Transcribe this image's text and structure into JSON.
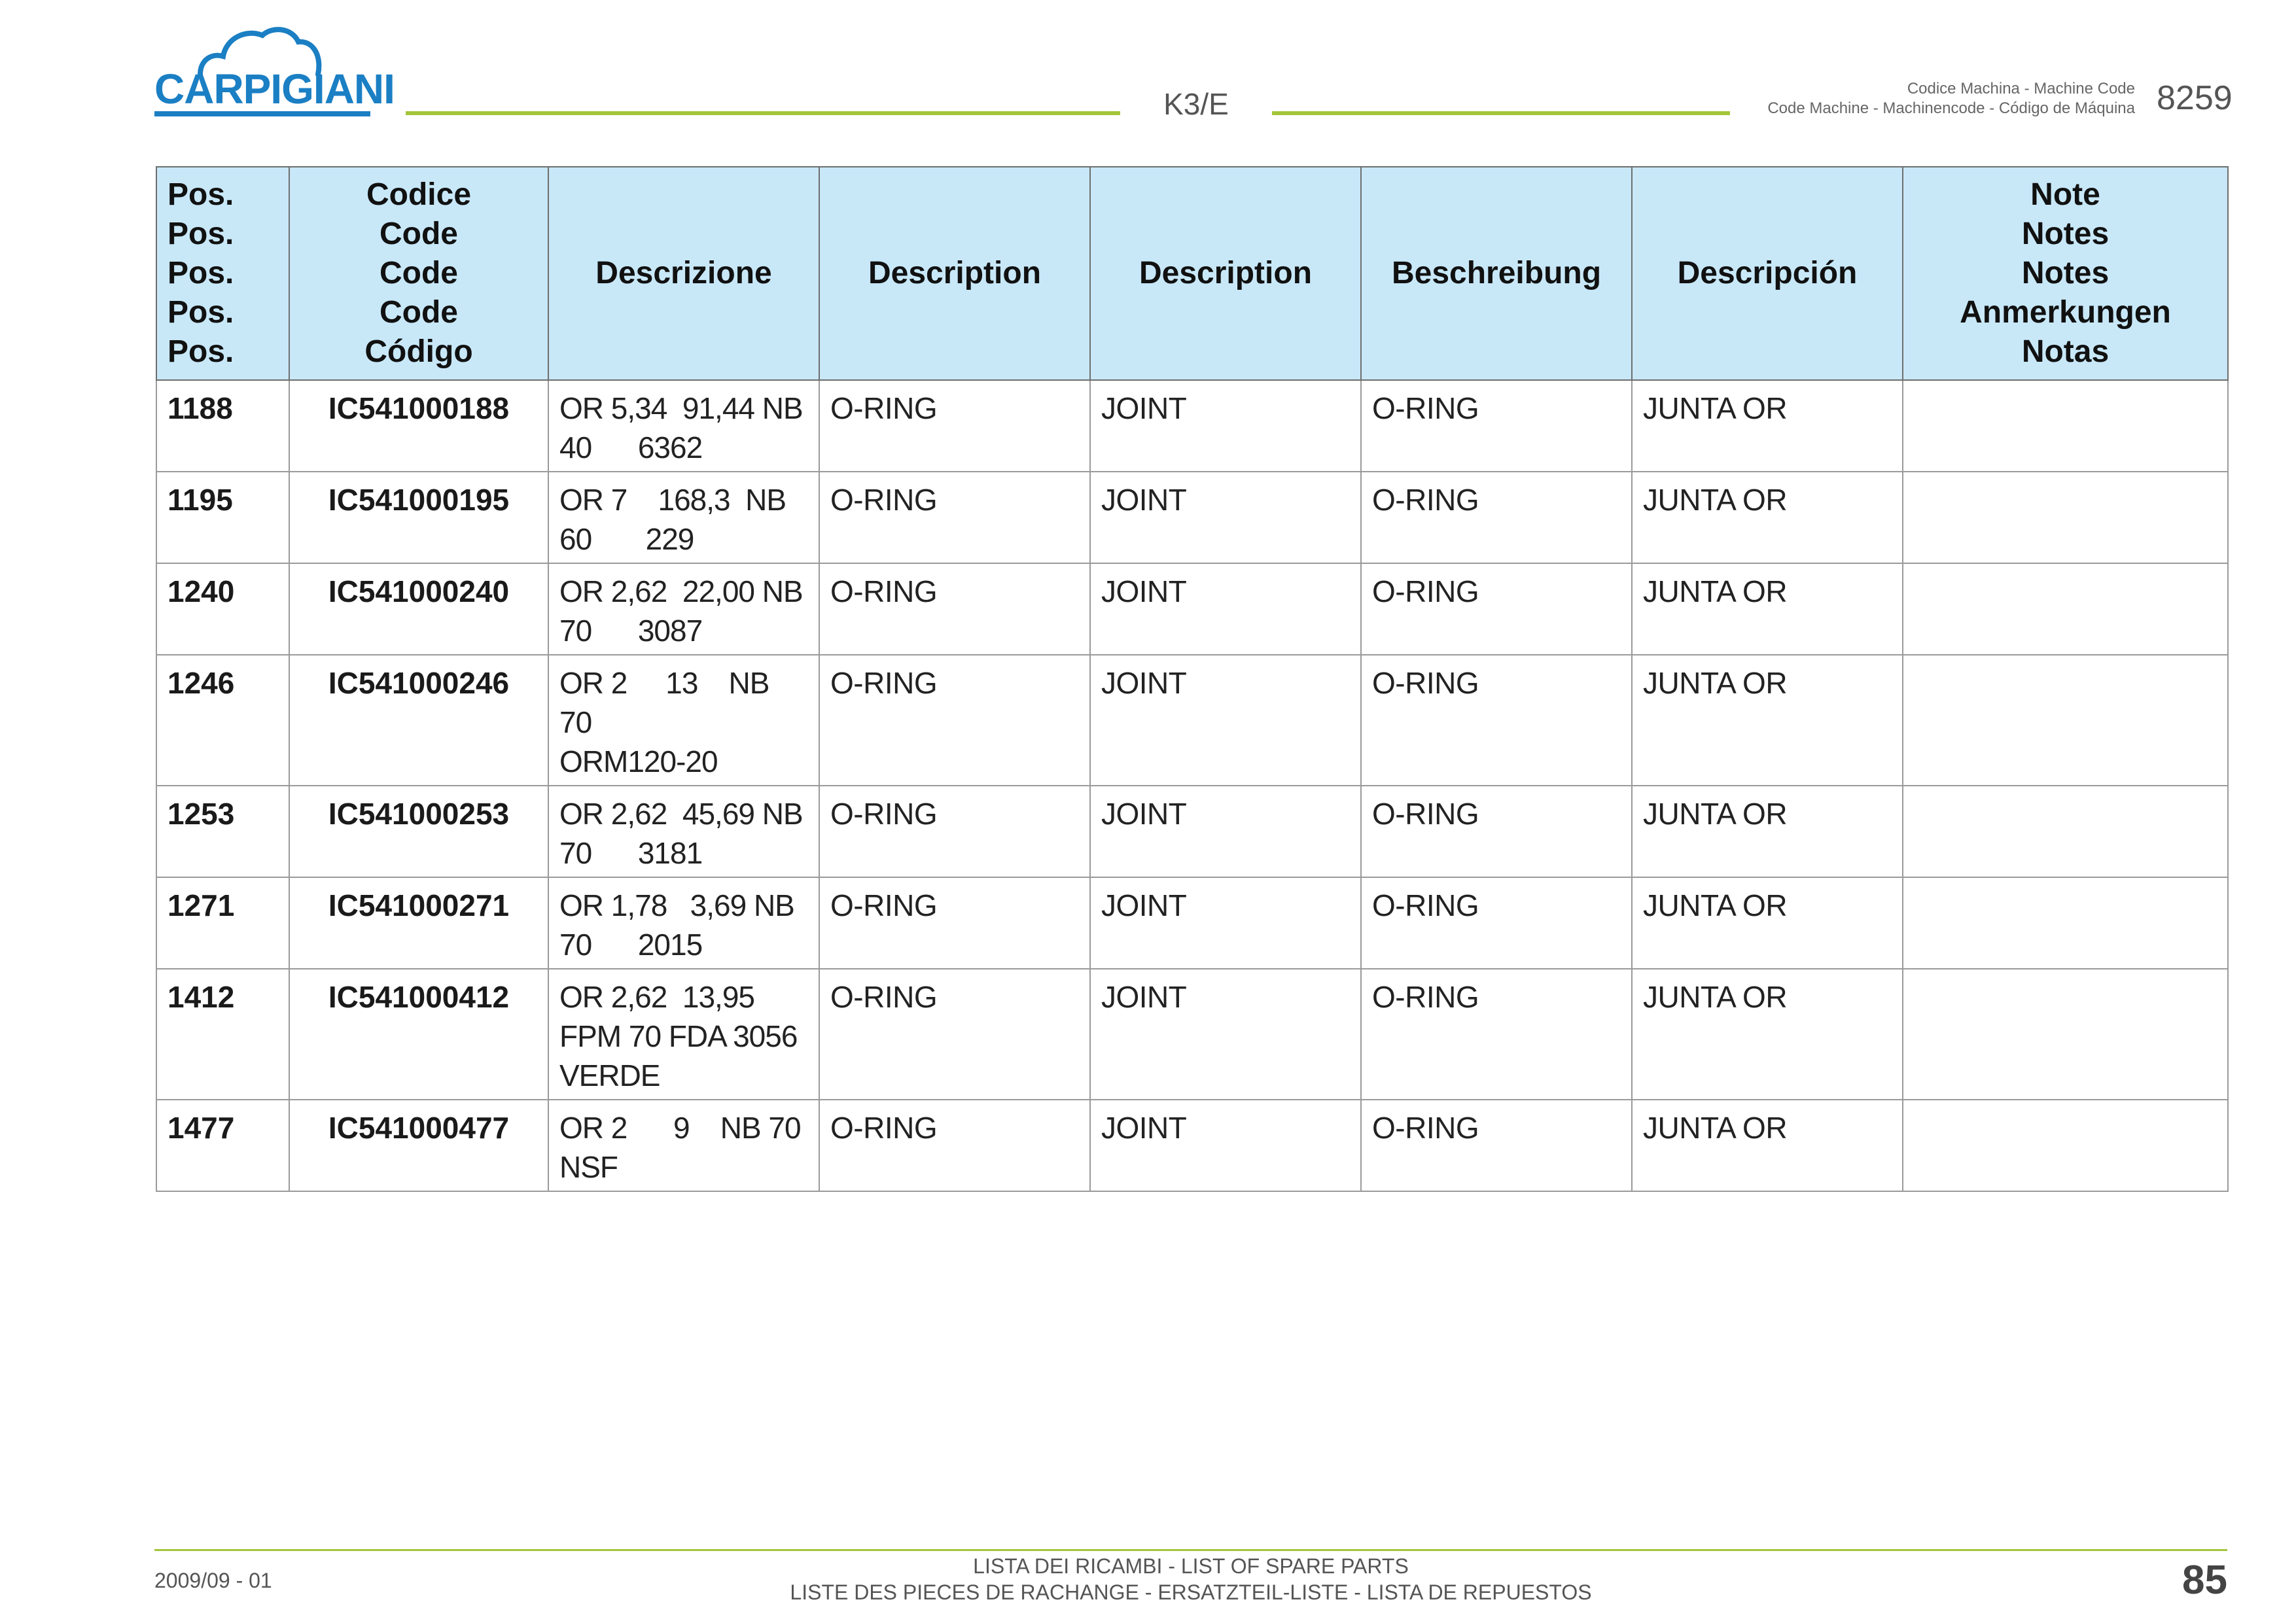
{
  "header": {
    "brand": "CARPIGIANI",
    "model": "K3/E",
    "machine_code_label_1": "Codice Machina - Machine Code",
    "machine_code_label_2": "Code Machine - Machinencode - Código de Máquina",
    "machine_code": "8259"
  },
  "table": {
    "columns": [
      {
        "key": "pos",
        "lines": [
          "Pos.",
          "Pos.",
          "Pos.",
          "Pos.",
          "Pos."
        ]
      },
      {
        "key": "code",
        "lines": [
          "Codice",
          "Code",
          "Code",
          "Code",
          "Código"
        ]
      },
      {
        "key": "descrizione",
        "lines": [
          "Descrizione"
        ]
      },
      {
        "key": "description_en",
        "lines": [
          "Description"
        ]
      },
      {
        "key": "description_fr",
        "lines": [
          "Description"
        ]
      },
      {
        "key": "beschreibung",
        "lines": [
          "Beschreibung"
        ]
      },
      {
        "key": "descripcion",
        "lines": [
          "Descripción"
        ]
      },
      {
        "key": "note",
        "lines": [
          "Note",
          "Notes",
          "Notes",
          "Anmerkungen",
          "Notas"
        ]
      }
    ],
    "rows": [
      {
        "pos": "1188",
        "code": "IC541000188",
        "descrizione": "OR 5,34  91,44 NB\n40      6362",
        "description_en": "O-RING",
        "description_fr": "JOINT",
        "beschreibung": "O-RING",
        "descripcion": "JUNTA OR",
        "note": ""
      },
      {
        "pos": "1195",
        "code": "IC541000195",
        "descrizione": "OR 7    168,3  NB\n60       229",
        "description_en": "O-RING",
        "description_fr": "JOINT",
        "beschreibung": "O-RING",
        "descripcion": "JUNTA OR",
        "note": ""
      },
      {
        "pos": "1240",
        "code": "IC541000240",
        "descrizione": "OR 2,62  22,00 NB\n70      3087",
        "description_en": "O-RING",
        "description_fr": "JOINT",
        "beschreibung": "O-RING",
        "descripcion": "JUNTA OR",
        "note": ""
      },
      {
        "pos": "1246",
        "code": "IC541000246",
        "descrizione": "OR 2     13    NB 70\nORM120-20",
        "description_en": "O-RING",
        "description_fr": "JOINT",
        "beschreibung": "O-RING",
        "descripcion": "JUNTA OR",
        "note": ""
      },
      {
        "pos": "1253",
        "code": "IC541000253",
        "descrizione": "OR 2,62  45,69 NB\n70      3181",
        "description_en": "O-RING",
        "description_fr": "JOINT",
        "beschreibung": "O-RING",
        "descripcion": "JUNTA OR",
        "note": ""
      },
      {
        "pos": "1271",
        "code": "IC541000271",
        "descrizione": "OR 1,78   3,69 NB\n70      2015",
        "description_en": "O-RING",
        "description_fr": "JOINT",
        "beschreibung": "O-RING",
        "descripcion": "JUNTA OR",
        "note": ""
      },
      {
        "pos": "1412",
        "code": "IC541000412",
        "descrizione": "OR 2,62  13,95\nFPM 70 FDA 3056\nVERDE",
        "description_en": "O-RING",
        "description_fr": "JOINT",
        "beschreibung": "O-RING",
        "descripcion": "JUNTA OR",
        "note": ""
      },
      {
        "pos": "1477",
        "code": "IC541000477",
        "descrizione": "OR 2      9    NB 70\nNSF",
        "description_en": "O-RING",
        "description_fr": "JOINT",
        "beschreibung": "O-RING",
        "descripcion": "JUNTA OR",
        "note": ""
      }
    ]
  },
  "footer": {
    "date": "2009/09 - 01",
    "title_1": "LISTA DEI RICAMBI - LIST OF SPARE PARTS",
    "title_2": "LISTE DES PIECES DE RACHANGE - ERSATZTEIL-LISTE - LISTA DE REPUESTOS",
    "page": "85"
  },
  "colors": {
    "brand_blue": "#1b7fc4",
    "accent_green": "#a3c639",
    "header_fill": "#c8e8f8"
  }
}
